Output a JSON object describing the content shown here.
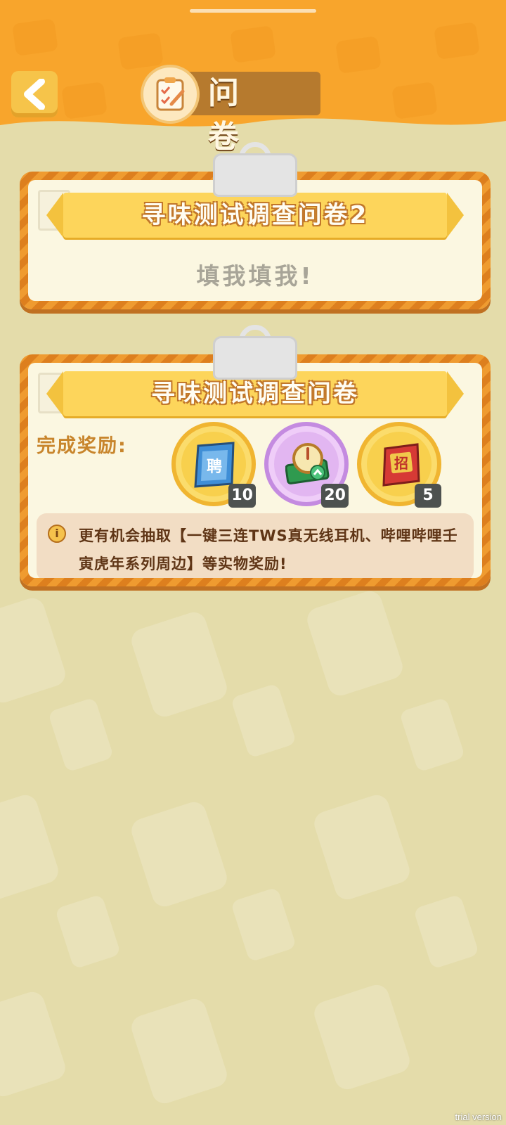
{
  "header": {
    "title": "问卷",
    "back_icon": "chevron-left-icon",
    "title_icon": "clipboard-checklist-icon"
  },
  "surveys": [
    {
      "title": "寻味测试调查问卷2",
      "cta": "填我填我!"
    },
    {
      "title": "寻味测试调查问卷",
      "reward_label": "完成奖励:",
      "rewards": [
        {
          "icon": "recruit-poster-icon",
          "count": "10"
        },
        {
          "icon": "speedup-clock-icon",
          "count": "20"
        },
        {
          "icon": "recruit-red-card-icon",
          "count": "5"
        }
      ],
      "notice": "更有机会抽取【一键三连TWS真无线耳机、哔哩哔哩壬寅虎年系列周边】等实物奖励!",
      "notice_icon": "info-icon"
    }
  ],
  "watermark": "trial version",
  "colors": {
    "header": "#f8a52c",
    "background": "#e4dcaa",
    "card_frame": "#ef9b30",
    "ribbon": "#fdd55b",
    "badge": "#4d514f"
  }
}
